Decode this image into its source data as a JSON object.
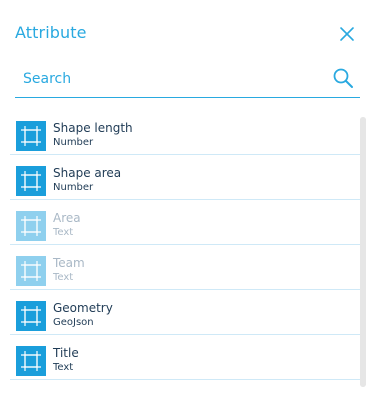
{
  "header": {
    "title": "Attribute",
    "close_icon": "close-icon"
  },
  "search": {
    "placeholder": "Search",
    "value": "",
    "icon": "search-icon"
  },
  "colors": {
    "accent": "#29a9e0",
    "tile": "#1a9edb",
    "tile_disabled": "#8fd0ee",
    "text": "#1f3b55",
    "text_disabled": "#a9b8c6"
  },
  "attributes": [
    {
      "name": "Shape length",
      "type": "Number",
      "enabled": true,
      "icon": "shape-icon"
    },
    {
      "name": "Shape area",
      "type": "Number",
      "enabled": true,
      "icon": "shape-icon"
    },
    {
      "name": "Area",
      "type": "Text",
      "enabled": false,
      "icon": "shape-icon"
    },
    {
      "name": "Team",
      "type": "Text",
      "enabled": false,
      "icon": "shape-icon"
    },
    {
      "name": "Geometry",
      "type": "GeoJson",
      "enabled": true,
      "icon": "shape-icon"
    },
    {
      "name": "Title",
      "type": "Text",
      "enabled": true,
      "icon": "shape-icon"
    }
  ]
}
